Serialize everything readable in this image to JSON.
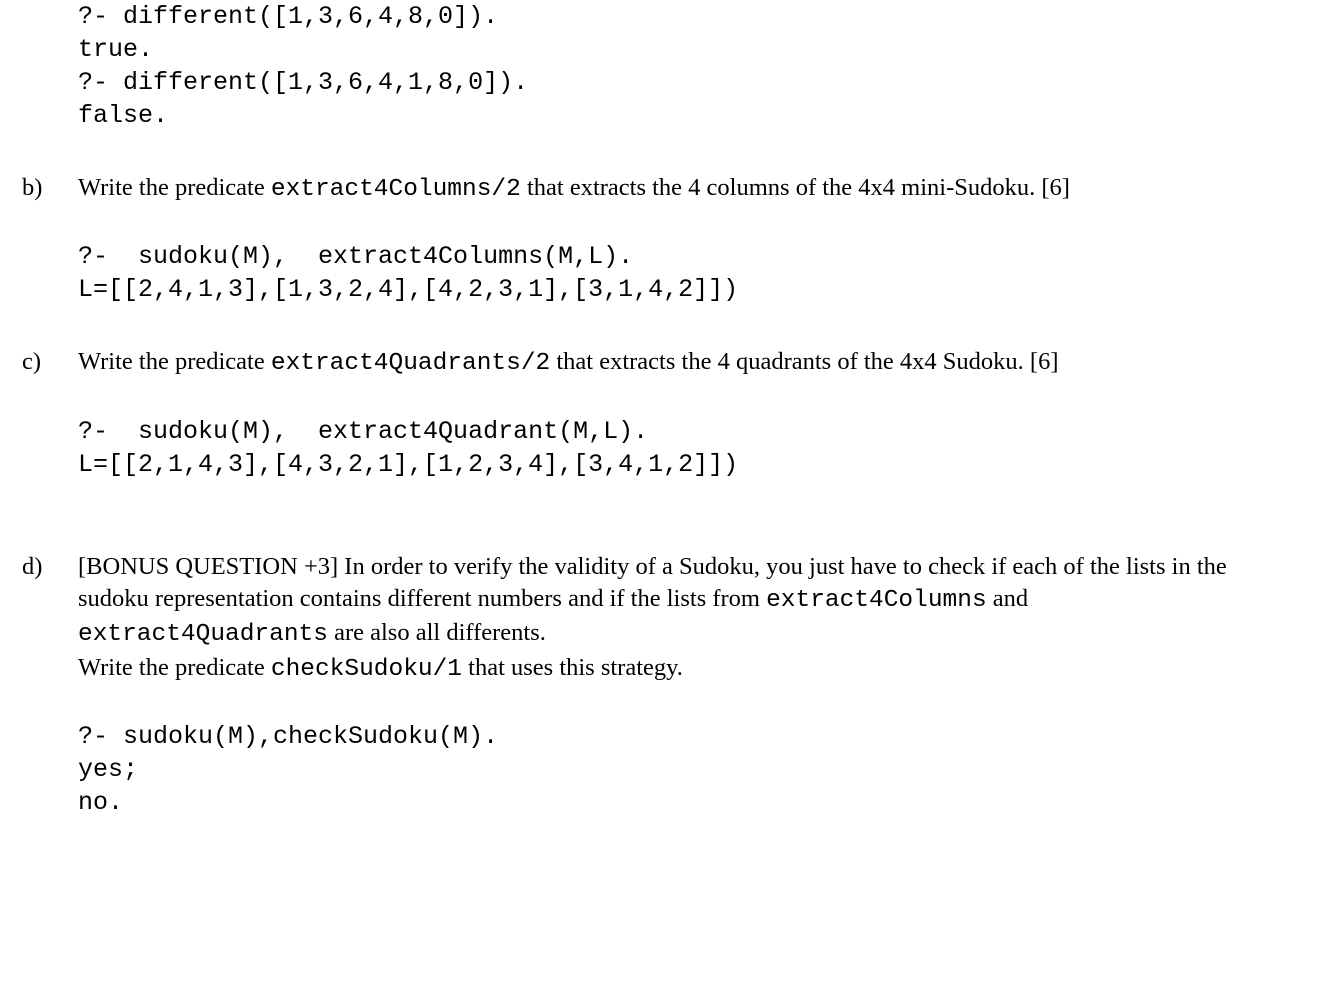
{
  "intro_code": "?- different([1,3,6,4,8,0]).\ntrue.\n?- different([1,3,6,4,1,8,0]).\nfalse.",
  "b": {
    "label": "b)",
    "text_pre": "Write the predicate ",
    "code1": "extract4Columns/2",
    "text_mid": " that extracts the 4 columns of the 4x4 mini-Sudoku. [6]",
    "example": "?-  sudoku(M),  extract4Columns(M,L).\nL=[[2,4,1,3],[1,3,2,4],[4,2,3,1],[3,1,4,2]])"
  },
  "c": {
    "label": "c)",
    "text_pre": "Write the predicate ",
    "code1": "extract4Quadrants/2",
    "text_mid": " that extracts the 4 quadrants of the 4x4 Sudoku. [6]",
    "example": "?-  sudoku(M),  extract4Quadrant(M,L).\nL=[[2,1,4,3],[4,3,2,1],[1,2,3,4],[3,4,1,2]])"
  },
  "d": {
    "label": "d)",
    "line1_pre": "[BONUS QUESTION +3] In order to verify the validity of a Sudoku, you just have to check if each of the lists in the sudoku representation contains different numbers and if the lists from ",
    "code1": "extract4Columns",
    "mid1": " and ",
    "code2": "extract4Quadrants",
    "mid2": " are also all differents.",
    "line2_pre": "Write the predicate ",
    "code3": "checkSudoku/1",
    "line2_post": " that uses this strategy.",
    "example": "?- sudoku(M),checkSudoku(M).\nyes;\nno."
  }
}
